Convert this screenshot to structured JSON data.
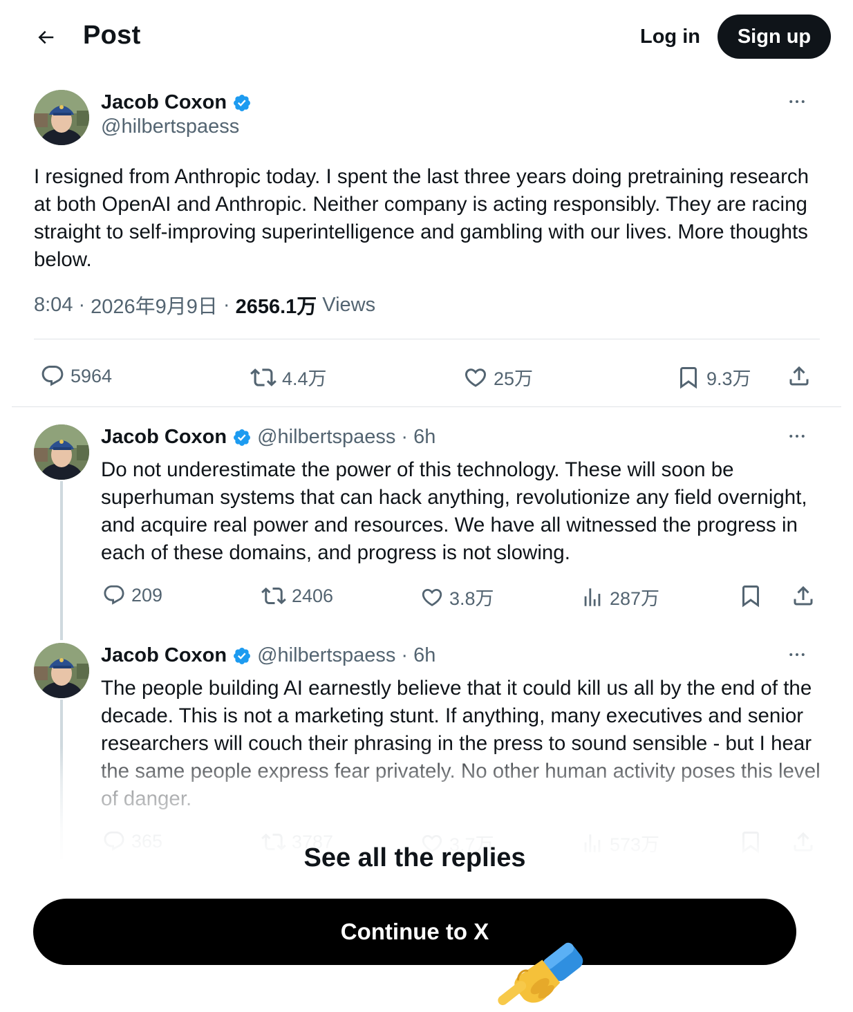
{
  "header": {
    "title": "Post",
    "login_label": "Log in",
    "signup_label": "Sign up"
  },
  "main_post": {
    "author_name": "Jacob Coxon",
    "handle": "@hilbertspaess",
    "text": "I resigned from Anthropic today. I spent the last three years doing pretraining research at both OpenAI and Anthropic. Neither company is acting responsibly. They are racing straight to self-improving superintelligence and gambling with our lives. More thoughts below.",
    "time": "8:04",
    "date": "2026年9月9日",
    "separator": "·",
    "views_count": "2656.1万",
    "views_label": "Views",
    "stats": {
      "replies": "5964",
      "reposts": "4.4万",
      "likes": "25万",
      "bookmarks": "9.3万"
    }
  },
  "replies": [
    {
      "author_name": "Jacob Coxon",
      "handle": "@hilbertspaess",
      "separator": "·",
      "time_ago": "6h",
      "text": "Do not underestimate the power of this technology. These will soon be superhuman systems that can hack anything, revolutionize any field overnight, and acquire real power and resources. We have all witnessed the progress in each of these domains, and progress is not slowing.",
      "stats": {
        "replies": "209",
        "reposts": "2406",
        "likes": "3.8万",
        "views": "287万"
      }
    },
    {
      "author_name": "Jacob Coxon",
      "handle": "@hilbertspaess",
      "separator": "·",
      "time_ago": "6h",
      "text": "The people building AI earnestly believe that it could kill us all by the end of the decade. This is not a marketing stunt. If anything, many executives and senior researchers will couch their phrasing in the press to sound sensible - but I hear the same people express fear privately. No other human activity poses this level of danger.",
      "stats": {
        "replies": "365",
        "reposts": "3787",
        "likes": "3.7万",
        "views": "573万"
      }
    }
  ],
  "cta": {
    "see_all_label": "See all the replies",
    "continue_label": "Continue to X"
  },
  "icons": {
    "back": "arrow-left-icon",
    "verified": "verified-badge-icon",
    "more": "more-horizontal-icon",
    "reply": "reply-bubble-icon",
    "repost": "repost-icon",
    "like": "heart-icon",
    "views": "bar-chart-icon",
    "bookmark": "bookmark-icon",
    "share": "share-upload-icon",
    "pointer": "pointing-hand-icon"
  },
  "colors": {
    "text_primary": "#0f1419",
    "text_secondary": "#536471",
    "verified_blue": "#1d9bf0",
    "button_dark": "#0f1419",
    "divider": "#dfe3e6"
  }
}
